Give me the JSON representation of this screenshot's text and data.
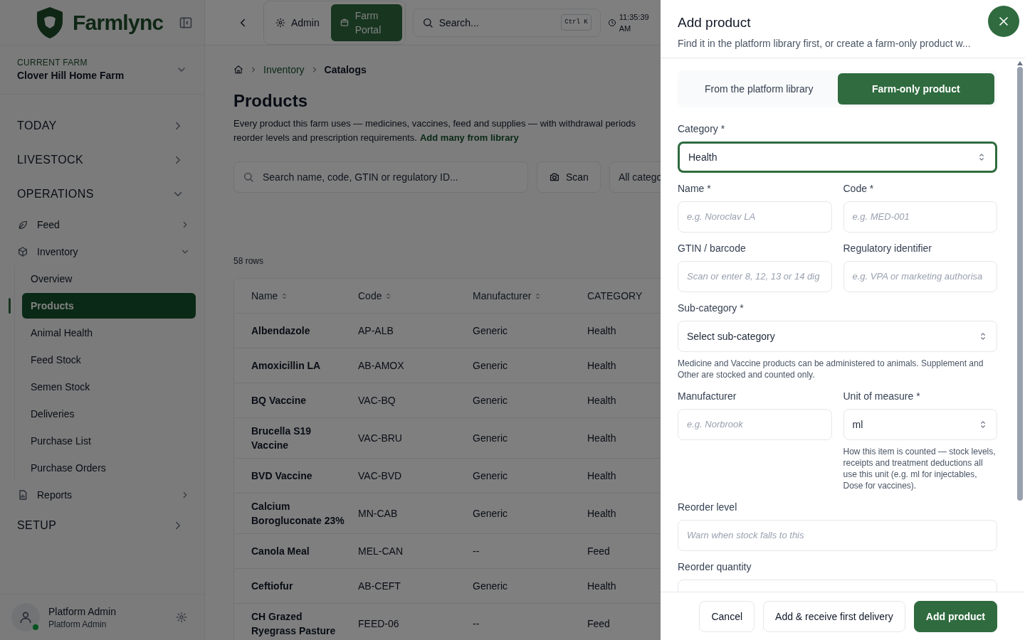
{
  "sidebar": {
    "logo": "Farmlync",
    "current_farm": {
      "label": "CURRENT FARM",
      "value": "Clover Hill Home Farm"
    },
    "sections": [
      {
        "label": "TODAY",
        "expanded": false
      },
      {
        "label": "LIVESTOCK",
        "expanded": false
      },
      {
        "label": "OPERATIONS",
        "expanded": true,
        "items": [
          {
            "label": "Feed",
            "expanded": false
          },
          {
            "label": "Inventory",
            "expanded": true,
            "children": [
              {
                "label": "Overview",
                "selected": false
              },
              {
                "label": "Products",
                "selected": true
              },
              {
                "label": "Animal Health",
                "selected": false
              },
              {
                "label": "Feed Stock",
                "selected": false
              },
              {
                "label": "Semen Stock",
                "selected": false
              },
              {
                "label": "Deliveries",
                "selected": false
              },
              {
                "label": "Purchase List",
                "selected": false
              },
              {
                "label": "Purchase Orders",
                "selected": false
              }
            ]
          },
          {
            "label": "Reports",
            "expanded": false
          }
        ]
      },
      {
        "label": "SETUP",
        "expanded": false
      }
    ],
    "user": {
      "name": "Platform Admin",
      "role": "Platform Admin"
    }
  },
  "topbar": {
    "tabs": [
      {
        "label": "Admin",
        "selected": false
      },
      {
        "label": "Farm Portal",
        "selected": true
      }
    ],
    "search": {
      "placeholder": "Search...",
      "shortcut": "Ctrl K"
    },
    "time": "11:35:39 AM"
  },
  "page": {
    "breadcrumb": [
      "Inventory",
      "Catalogs"
    ],
    "title": "Products",
    "description_line_1": "Every product this farm uses — medicines, vaccines, feed and supplies — with withdrawal periods",
    "description_line_2": "reorder levels and prescription requirements.",
    "description_link": "Add many from library",
    "search": {
      "placeholder": "Search name, code, GTIN or regulatory ID..."
    },
    "scan_button": "Scan",
    "filter": "All catego",
    "row_count": "58 rows",
    "table": {
      "columns": [
        {
          "label": "Name",
          "sortable": true
        },
        {
          "label": "Code",
          "sortable": true
        },
        {
          "label": "Manufacturer",
          "sortable": true
        },
        {
          "label": "CATEGORY",
          "sortable": false
        }
      ],
      "rows": [
        [
          "Albendazole",
          "AP-ALB",
          "Generic",
          "Health"
        ],
        [
          "Amoxicillin LA",
          "AB-AMOX",
          "Generic",
          "Health"
        ],
        [
          "BQ Vaccine",
          "VAC-BQ",
          "Generic",
          "Health"
        ],
        [
          "Brucella S19 Vaccine",
          "VAC-BRU",
          "Generic",
          "Health"
        ],
        [
          "BVD Vaccine",
          "VAC-BVD",
          "Generic",
          "Health"
        ],
        [
          "Calcium Borogluconate 23%",
          "MN-CAB",
          "Generic",
          "Health"
        ],
        [
          "Canola Meal",
          "MEL-CAN",
          "--",
          "Feed"
        ],
        [
          "Ceftiofur",
          "AB-CEFT",
          "Generic",
          "Health"
        ],
        [
          "CH Grazed Ryegrass Pasture",
          "FEED-06",
          "--",
          "Feed"
        ]
      ]
    }
  },
  "drawer": {
    "title": "Add product",
    "subtitle": "Find it in the platform library first, or create a farm-only product w...",
    "modes": [
      {
        "label": "From the platform library",
        "selected": false
      },
      {
        "label": "Farm-only product",
        "selected": true
      }
    ],
    "rows": [
      [
        {
          "kind": "select",
          "label": "Category *",
          "value": "Health",
          "focused": true
        }
      ],
      [
        {
          "kind": "input",
          "label": "Name *",
          "placeholder": "e.g. Noroclav LA",
          "focused": false
        },
        {
          "kind": "input",
          "label": "Code *",
          "placeholder": "e.g. MED-001",
          "focused": false
        }
      ],
      [
        {
          "kind": "input",
          "label": "GTIN / barcode",
          "placeholder": "Scan or enter 8, 12, 13 or 14 dig",
          "focused": false
        },
        {
          "kind": "input",
          "label": "Regulatory identifier",
          "placeholder": "e.g. VPA or marketing authorisa",
          "focused": false
        }
      ],
      [
        {
          "kind": "select",
          "label": "Sub-category *",
          "value": "Select sub-category",
          "focused": false,
          "help": "Medicine and Vaccine products can be administered to animals. Supplement and Other are stocked and counted only."
        }
      ],
      [
        {
          "kind": "input",
          "label": "Manufacturer",
          "placeholder": "e.g. Norbrook",
          "focused": false
        },
        {
          "kind": "select",
          "label": "Unit of measure *",
          "value": "ml",
          "focused": false,
          "help": "How this item is counted — stock levels, receipts and treatment deductions all use this unit (e.g. ml for injectables, Dose for vaccines)."
        }
      ],
      [
        {
          "kind": "input",
          "label": "Reorder level",
          "placeholder": "Warn when stock falls to this",
          "focused": false
        }
      ],
      [
        {
          "kind": "input",
          "label": "Reorder quantity",
          "focused": false
        }
      ]
    ],
    "buttons": [
      {
        "label": "Cancel",
        "kind": "secondary"
      },
      {
        "label": "Add & receive first delivery",
        "kind": "secondary"
      },
      {
        "label": "Add product",
        "kind": "primary"
      }
    ]
  }
}
